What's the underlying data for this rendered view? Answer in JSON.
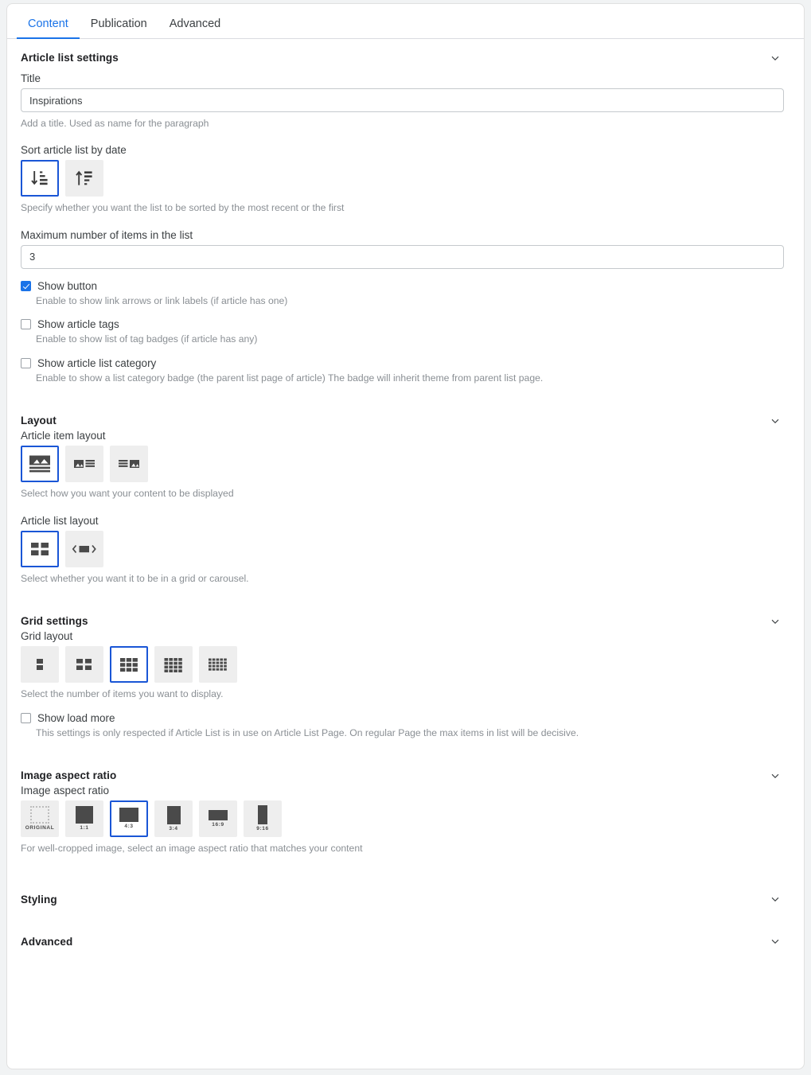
{
  "tabs": [
    {
      "label": "Content",
      "active": true
    },
    {
      "label": "Publication",
      "active": false
    },
    {
      "label": "Advanced",
      "active": false
    }
  ],
  "sections": {
    "article_list_settings": {
      "title": "Article list settings",
      "title_field": {
        "label": "Title",
        "value": "Inspirations",
        "help": "Add a title. Used as name for the paragraph"
      },
      "sort": {
        "label": "Sort article list by date",
        "help": "Specify whether you want the list to be sorted by the most recent or the first",
        "options": [
          {
            "name": "sort-descending",
            "selected": true
          },
          {
            "name": "sort-ascending",
            "selected": false
          }
        ]
      },
      "max_items": {
        "label": "Maximum number of items in the list",
        "value": "3"
      },
      "checkboxes": [
        {
          "label": "Show button",
          "checked": true,
          "help": "Enable to show link arrows or link labels (if article has one)"
        },
        {
          "label": "Show article tags",
          "checked": false,
          "help": "Enable to show list of tag badges (if article has any)"
        },
        {
          "label": "Show article list category",
          "checked": false,
          "help": "Enable to show a list category badge (the parent list page of article) The badge will inherit theme from parent list page."
        }
      ]
    },
    "layout": {
      "title": "Layout",
      "item_layout": {
        "label": "Article item layout",
        "help": "Select how you want your content to be displayed",
        "options": [
          {
            "name": "image-top",
            "selected": true
          },
          {
            "name": "image-left",
            "selected": false
          },
          {
            "name": "image-right",
            "selected": false
          }
        ]
      },
      "list_layout": {
        "label": "Article list layout",
        "help": "Select whether you want it to be in a grid or carousel.",
        "options": [
          {
            "name": "grid",
            "selected": true
          },
          {
            "name": "carousel",
            "selected": false
          }
        ]
      }
    },
    "grid_settings": {
      "title": "Grid settings",
      "grid_layout": {
        "label": "Grid layout",
        "help": "Select the number of items you want to display.",
        "options": [
          {
            "name": "grid-1-column",
            "cols": 1,
            "rows": 2,
            "selected": false
          },
          {
            "name": "grid-2-columns",
            "cols": 2,
            "rows": 2,
            "selected": false
          },
          {
            "name": "grid-3-columns",
            "cols": 3,
            "rows": 3,
            "selected": true
          },
          {
            "name": "grid-4-columns",
            "cols": 4,
            "rows": 4,
            "selected": false
          },
          {
            "name": "grid-5-columns",
            "cols": 5,
            "rows": 4,
            "selected": false
          }
        ]
      },
      "load_more": {
        "label": "Show load more",
        "checked": false,
        "help": "This settings is only respected if Article List is in use on Article List Page. On regular Page the max items in list will be decisive."
      }
    },
    "image_aspect_ratio": {
      "title": "Image aspect ratio",
      "label": "Image aspect ratio",
      "help": "For well-cropped image, select an image aspect ratio that matches your content",
      "options": [
        {
          "caption": "ORIGINAL",
          "name": "ratio-original",
          "selected": false
        },
        {
          "caption": "1:1",
          "name": "ratio-1-1",
          "selected": false
        },
        {
          "caption": "4:3",
          "name": "ratio-4-3",
          "selected": true
        },
        {
          "caption": "3:4",
          "name": "ratio-3-4",
          "selected": false
        },
        {
          "caption": "16:9",
          "name": "ratio-16-9",
          "selected": false
        },
        {
          "caption": "9:16",
          "name": "ratio-9-16",
          "selected": false
        }
      ]
    },
    "styling": {
      "title": "Styling"
    },
    "advanced": {
      "title": "Advanced"
    }
  },
  "colors": {
    "accent": "#1a73e8",
    "selected_border": "#1a56d6",
    "icon_fill": "#4a4a4a",
    "help_text": "#8a8f94"
  }
}
